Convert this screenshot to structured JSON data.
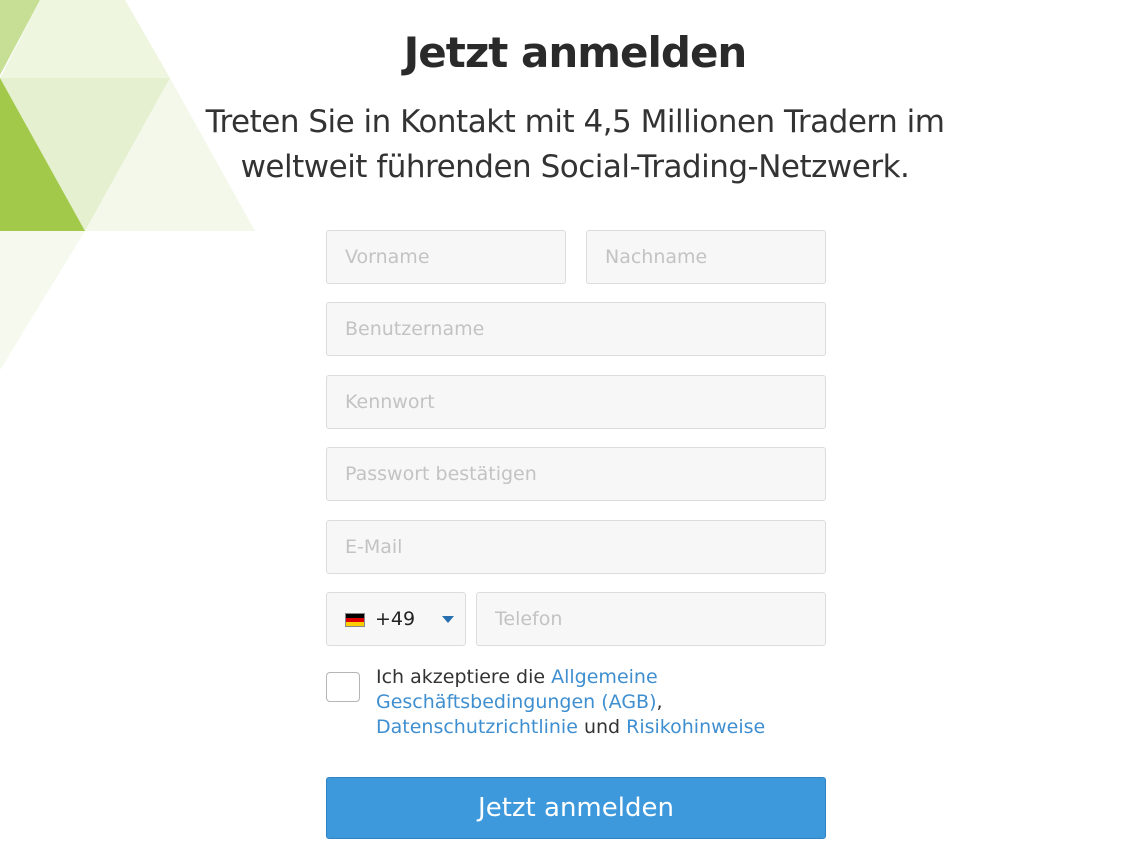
{
  "colors": {
    "accent_green": "#a3c94a",
    "light_green": "#e3f0cc",
    "button_blue": "#3d99dc",
    "link_blue": "#3f8fd0"
  },
  "header": {
    "title": "Jetzt anmelden",
    "subtitle_line1": "Treten Sie in Kontakt mit 4,5 Millionen Tradern im",
    "subtitle_line2": "weltweit führenden Social-Trading-Netzwerk."
  },
  "form": {
    "first_name": {
      "placeholder": "Vorname",
      "value": ""
    },
    "last_name": {
      "placeholder": "Nachname",
      "value": ""
    },
    "username": {
      "placeholder": "Benutzername",
      "value": ""
    },
    "password": {
      "placeholder": "Kennwort",
      "value": ""
    },
    "password_confirm": {
      "placeholder": "Passwort bestätigen",
      "value": ""
    },
    "email": {
      "placeholder": "E-Mail",
      "value": ""
    },
    "country": {
      "flag_icon": "germany-flag-icon",
      "dial_code": "+49"
    },
    "phone": {
      "placeholder": "Telefon",
      "value": ""
    },
    "terms": {
      "prefix": "Ich akzeptiere die ",
      "agb_link": "Allgemeine Geschäftsbedingungen (AGB)",
      "comma": ",",
      "privacy_link": "Datenschutzrichtlinie",
      "and": " und ",
      "risk_link": "Risikohinweise",
      "checked": false
    },
    "submit_label": "Jetzt anmelden"
  }
}
